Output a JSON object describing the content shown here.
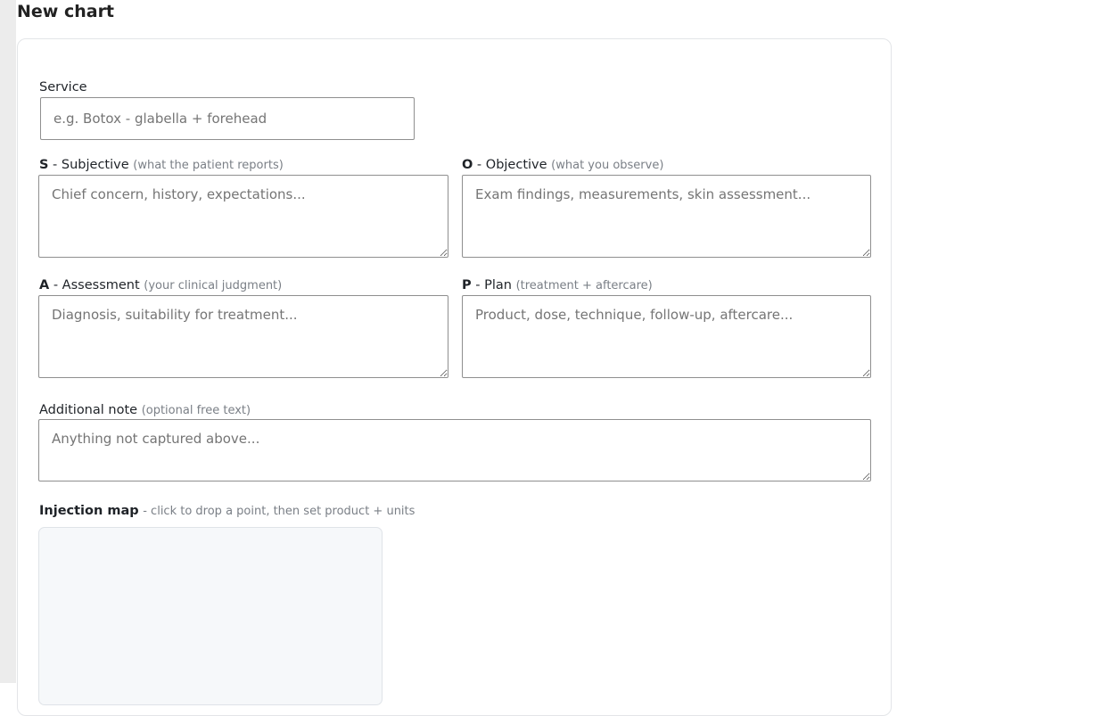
{
  "page": {
    "title": "New chart"
  },
  "form": {
    "service": {
      "label": "Service",
      "placeholder": "e.g. Botox - glabella + forehead",
      "value": ""
    },
    "subjective": {
      "label_prefix": "S",
      "label_name": " - Subjective",
      "hint": "(what the patient reports)",
      "placeholder": "Chief concern, history, expectations..."
    },
    "objective": {
      "label_prefix": "O",
      "label_name": " - Objective",
      "hint": "(what you observe)",
      "placeholder": "Exam findings, measurements, skin assessment..."
    },
    "assessment": {
      "label_prefix": "A",
      "label_name": " - Assessment",
      "hint": "(your clinical judgment)",
      "placeholder": "Diagnosis, suitability for treatment..."
    },
    "plan": {
      "label_prefix": "P",
      "label_name": " - Plan",
      "hint": "(treatment + aftercare)",
      "placeholder": "Product, dose, technique, follow-up, aftercare..."
    },
    "additional_note": {
      "label": "Additional note",
      "hint": "(optional free text)",
      "placeholder": "Anything not captured above..."
    },
    "injection_map": {
      "label": "Injection map",
      "hint": "- click to drop a point, then set product + units"
    }
  }
}
